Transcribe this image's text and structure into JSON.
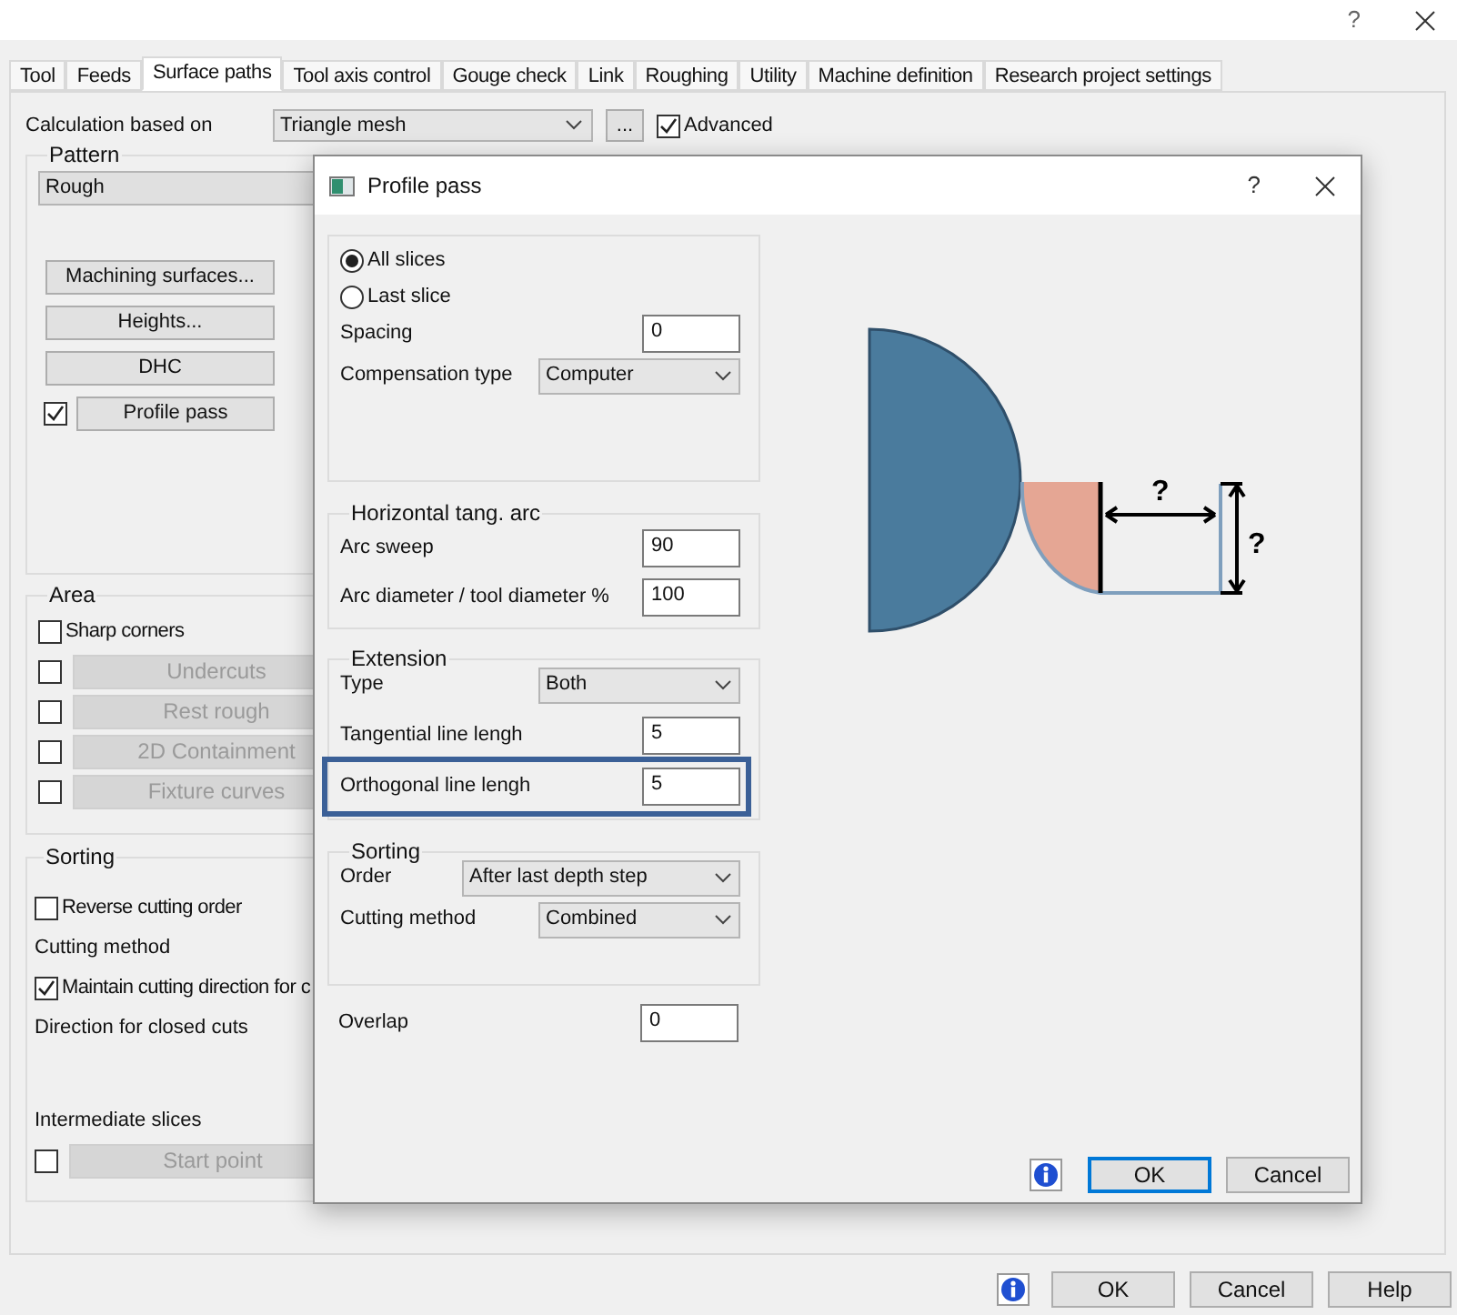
{
  "window": {
    "help": "?"
  },
  "tabs": [
    {
      "label": "Tool",
      "selected": false
    },
    {
      "label": "Feeds",
      "selected": false
    },
    {
      "label": "Surface paths",
      "selected": true
    },
    {
      "label": "Tool axis control",
      "selected": false
    },
    {
      "label": "Gouge check",
      "selected": false
    },
    {
      "label": "Link",
      "selected": false
    },
    {
      "label": "Roughing",
      "selected": false
    },
    {
      "label": "Utility",
      "selected": false
    },
    {
      "label": "Machine definition",
      "selected": false
    },
    {
      "label": "Research project settings",
      "selected": false
    }
  ],
  "calculation": {
    "label": "Calculation based on",
    "value": "Triangle mesh",
    "more": "...",
    "advanced": {
      "label": "Advanced",
      "checked": true
    }
  },
  "pattern": {
    "title": "Pattern",
    "value": "Rough",
    "buttons": [
      {
        "kind": "button",
        "label": "Machining surfaces..."
      },
      {
        "kind": "button",
        "label": "Heights..."
      },
      {
        "kind": "button",
        "label": "DHC"
      },
      {
        "kind": "check_button",
        "label": "Profile pass",
        "checked": true,
        "disabled": false
      }
    ]
  },
  "area": {
    "title": "Area",
    "items": [
      {
        "kind": "check",
        "label": "Sharp corners",
        "checked": false
      },
      {
        "kind": "check_button",
        "label": "Undercuts",
        "checked": false,
        "disabled": true
      },
      {
        "kind": "check_button",
        "label": "Rest rough",
        "checked": false,
        "disabled": true
      },
      {
        "kind": "check_button",
        "label": "2D Containment",
        "checked": false,
        "disabled": true
      },
      {
        "kind": "check_button",
        "label": "Fixture curves",
        "checked": false,
        "disabled": true
      }
    ]
  },
  "sorting": {
    "title": "Sorting",
    "items": [
      {
        "kind": "check",
        "label": "Reverse cutting order",
        "checked": false
      },
      {
        "kind": "label",
        "label": "Cutting method"
      },
      {
        "kind": "check",
        "label": "Maintain cutting direction for c",
        "checked": true
      },
      {
        "kind": "label",
        "label": "Direction for closed cuts"
      },
      {
        "kind": "label",
        "label": "Intermediate slices"
      },
      {
        "kind": "check_button",
        "label": "Start point",
        "checked": false,
        "disabled": true
      }
    ]
  },
  "footer": {
    "buttons": [
      {
        "label": "OK"
      },
      {
        "label": "Cancel"
      },
      {
        "label": "Help"
      }
    ]
  },
  "dialog": {
    "title": "Profile pass",
    "help": "?",
    "slices": [
      {
        "label": "All slices",
        "selected": true
      },
      {
        "label": "Last slice",
        "selected": false
      }
    ],
    "groups": [
      {
        "rows": [
          {
            "kind": "field",
            "label": "Spacing",
            "value": "0",
            "highlighted": false
          },
          {
            "kind": "dropdown",
            "label": "Compensation type",
            "value": "Computer",
            "highlighted": false
          }
        ]
      },
      {
        "title": "Horizontal tang. arc",
        "rows": [
          {
            "kind": "field",
            "label": "Arc sweep",
            "value": "90",
            "highlighted": false
          },
          {
            "kind": "field",
            "label": "Arc diameter / tool diameter %",
            "value": "100",
            "highlighted": false
          }
        ]
      },
      {
        "title": "Extension",
        "rows": [
          {
            "kind": "dropdown",
            "label": "Type",
            "value": "Both",
            "highlighted": false
          },
          {
            "kind": "field",
            "label": "Tangential line lengh",
            "value": "5",
            "highlighted": false
          },
          {
            "kind": "field",
            "label": "Orthogonal line lengh",
            "value": "5",
            "highlighted": true
          }
        ]
      },
      {
        "title": "Sorting",
        "rows": [
          {
            "kind": "dropdown",
            "label": "Order",
            "value": "After last depth step",
            "highlighted": false
          },
          {
            "kind": "dropdown",
            "label": "Cutting method",
            "value": "Combined",
            "highlighted": false
          }
        ]
      }
    ],
    "overlap": {
      "kind": "field",
      "label": "Overlap",
      "value": "0",
      "highlighted": false
    },
    "diagram": {
      "labels": [
        "?",
        "?"
      ]
    },
    "buttons": [
      {
        "label": "OK",
        "default": true
      },
      {
        "label": "Cancel",
        "default": false
      }
    ]
  }
}
